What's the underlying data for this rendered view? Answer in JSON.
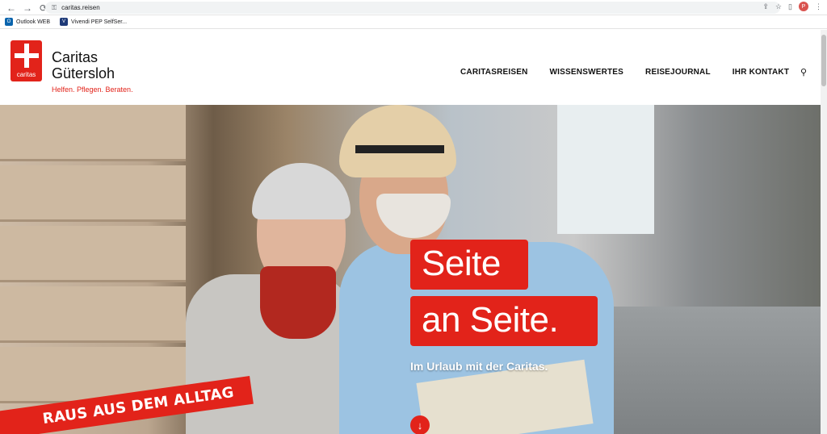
{
  "browser": {
    "url": "caritas.reisen",
    "back_icon": "←",
    "forward_icon": "→",
    "reload_icon": "⟳",
    "lock_icon": "🔒",
    "avatar_letter": "P",
    "bookmarks": [
      {
        "label": "Outlook WEB",
        "icon_color": "#0a64ad",
        "icon_text": "O"
      },
      {
        "label": "Vivendi PEP SelfSer...",
        "icon_color": "#1e3a78",
        "icon_text": "V"
      }
    ]
  },
  "header": {
    "logo_word": "caritas",
    "brand_line1": "Caritas",
    "brand_line2": "Gütersloh",
    "tagline": "Helfen. Pflegen. Beraten.",
    "nav": [
      "CARITASREISEN",
      "WISSENSWERTES",
      "REISEJOURNAL",
      "IHR KONTAKT"
    ]
  },
  "hero": {
    "headline_line1": "Seite",
    "headline_line2": "an Seite.",
    "subheadline": "Im Urlaub mit der Caritas.",
    "badge": "RAUS AUS DEM ALLTAG",
    "scroll_icon": "↓"
  },
  "colors": {
    "accent": "#e2231a",
    "text": "#111111"
  }
}
